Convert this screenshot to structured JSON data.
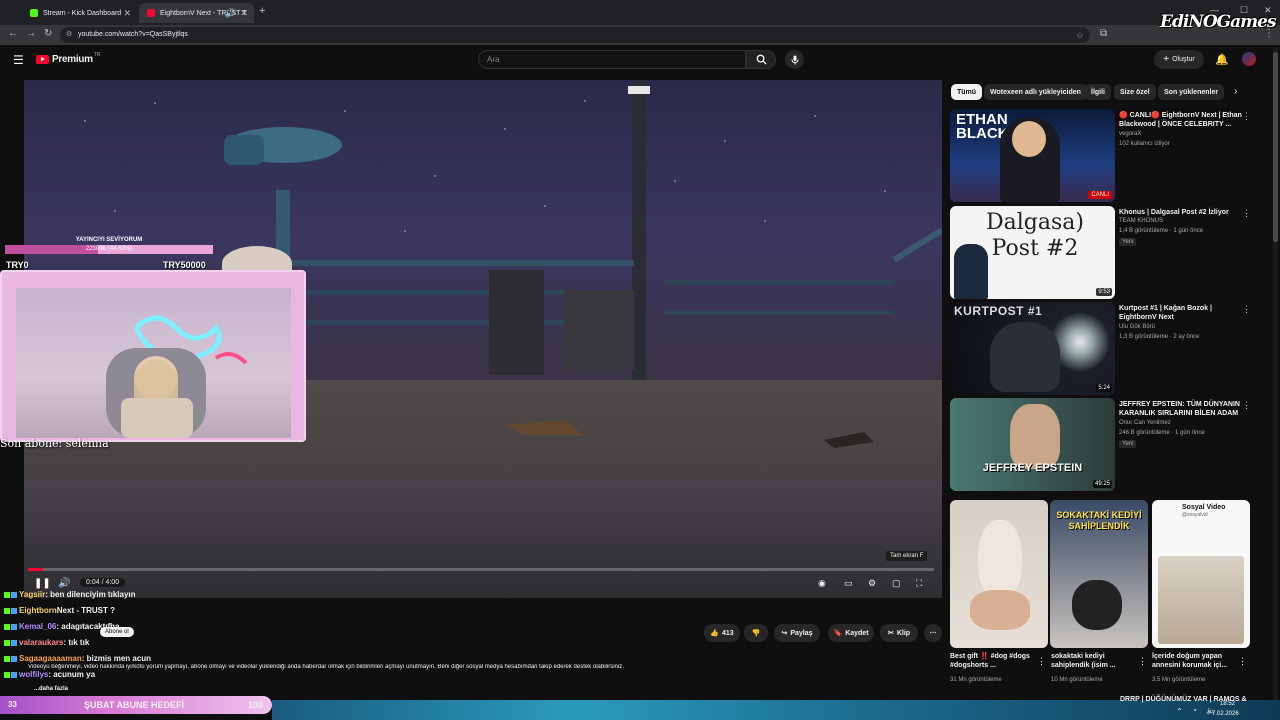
{
  "browser": {
    "tabs": [
      {
        "label": "Stream - Kick Dashboard",
        "active": false
      },
      {
        "label": "EightbornV Next - TRUST T",
        "active": true
      }
    ],
    "url": "youtube.com/watch?v=QasSByjtlqs"
  },
  "youtube": {
    "logo": "Premium",
    "logo_region": "TR",
    "search_placeholder": "Ara",
    "create_label": "Oluştur"
  },
  "player": {
    "time": "0:04 / 4:00",
    "progress": 0.0167,
    "fullscreen_tooltip": "Tam ekran",
    "fullscreen_key": "F"
  },
  "overlay": {
    "goal_title": "YAYINCIYI SEVİYORUM",
    "goal_progress": "22306₺ (44.60%)",
    "goal_min": "TRY0",
    "goal_max": "TRY50000",
    "last_sub": "Son abone: selenna",
    "sub_goal_count": "33",
    "sub_goal_title": "ŞUBAT ABUNE HEDEFİ",
    "sub_goal_target": "100",
    "chat": [
      {
        "user": "Yagsiir",
        "msg": ": ben dilenciyim tıklayın",
        "color": "#f6d365"
      },
      {
        "user": "Eightborn",
        "msg": " Next - TRUST ?",
        "color": "#f6d365"
      },
      {
        "user": "Kemal_06",
        "msg": ": adagıtacaktıfha",
        "color": "#b38cff"
      },
      {
        "user": "valaraukars",
        "msg": ": tık tık",
        "color": "#ff8a8a"
      },
      {
        "user": "Sagaagaaaaman",
        "msg": " : bizmis men acun",
        "color": "#f6a04d"
      },
      {
        "user": "wolfilys",
        "msg": ": acunum ya",
        "color": "#b38cff"
      }
    ],
    "subscribe_popup": "Abone ol"
  },
  "actions": {
    "likes": "413",
    "share": "Paylaş",
    "save": "Kaydet",
    "clip": "Klip"
  },
  "description": {
    "text": "Videoyu beğenmeyi, video hakkında iyi/kötü yorum yapmayı, abone olmayı ve videolar yüklendiği anda haberdar olmak için bildirimleri açmayı unutmayın. Beni diğer sosyal medya hesabımdan takip ederek destek olabilirsiniz.",
    "more": "...daha fazla"
  },
  "chips": [
    "Tümü",
    "Wotexeen adlı yükleyiciden",
    "İlgili",
    "Size özel",
    "Son yüklenenler"
  ],
  "recommendations": [
    {
      "title": "🔴 CANLI🔴 EightbornV Next | Ethan Blackwood | ÖNCE CELEBRITY ...",
      "channel": "vegoraX",
      "meta": "102 kullanıcı izliyor",
      "thumb_text": "ETHAN BLACKWOOD",
      "badge": "CANLI",
      "duration": ""
    },
    {
      "title": "Khonus | Dalgasal Post #2 İzliyor",
      "channel": "TEAM KHONUS",
      "meta": "1,4 B görüntüleme · 1 gün önce",
      "thumb_text": "Dalgasa) Post #2",
      "badge": "Yeni",
      "duration": "9:53"
    },
    {
      "title": "Kurtpost #1 | Kağan Bozok | EightbornV Next",
      "channel": "Ulu Gök Börü",
      "meta": "1,3 B görüntüleme · 2 ay önce",
      "thumb_text": "KURTPOST #1",
      "badge": "",
      "duration": "5:24"
    },
    {
      "title": "JEFFREY EPSTEIN: TÜM DÜNYANIN KARANLIK SIRLARINI BİLEN ADAM",
      "channel": "Onur Can Yenilmez",
      "meta": "246 B görüntüleme · 1 gün önce",
      "thumb_text": "JEFFREY EPSTEIN",
      "badge": "Yeni",
      "duration": "49:25"
    }
  ],
  "shorts": [
    {
      "title": "Best gift ‼️ #dog #dogs #dogshorts ...",
      "views": "31 Mn görüntüleme"
    },
    {
      "title": "sokaktaki kediyi sahiplendik (isim ...",
      "views": "10 Mn görüntüleme",
      "overlay": "SOKAKTAKİ KEDİYİ SAHİPLENDİK"
    },
    {
      "title": "İçeride doğum yapan annesini korumak içi...",
      "views": "3,5 Mn görüntüleme",
      "overlay": "Sosyal Video",
      "handle": "@sosyalvid"
    }
  ],
  "next_rec_partial": "DRRP | DÜĞÜNÜMÜZ VAR | RAMOS &",
  "taskbar": {
    "time": "18:52",
    "date": "7.02.2026"
  },
  "watermark": "EdiNOGames"
}
